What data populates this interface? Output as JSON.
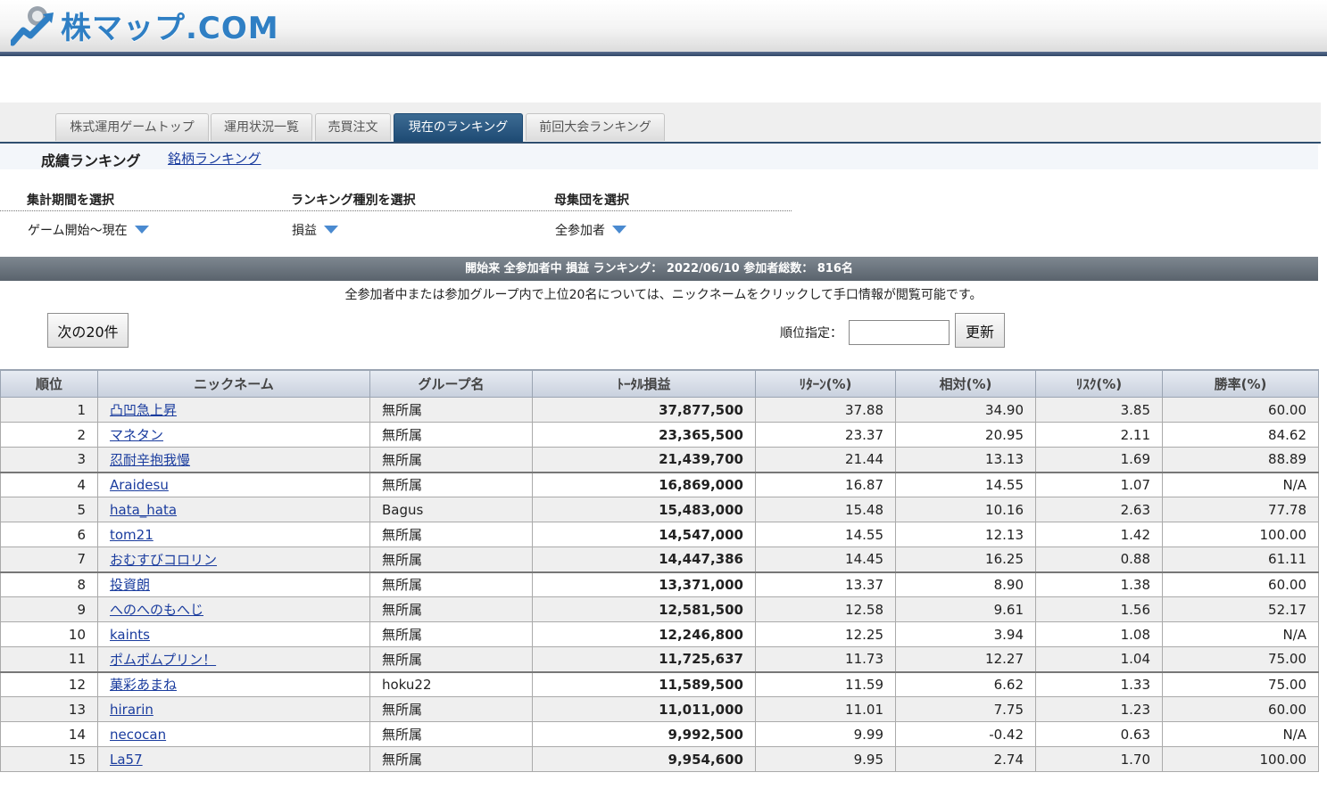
{
  "site": {
    "logo_text": "株マップ.COM"
  },
  "tabs": [
    {
      "label": "株式運用ゲームトップ"
    },
    {
      "label": "運用状況一覧"
    },
    {
      "label": "売買注文"
    },
    {
      "label": "現在のランキング",
      "active": true
    },
    {
      "label": "前回大会ランキング"
    }
  ],
  "subnav": {
    "current": "成績ランキング",
    "link": "銘柄ランキング"
  },
  "filters": [
    {
      "heading": "集計期間を選択",
      "value": "ゲーム開始～現在"
    },
    {
      "heading": "ランキング種別を選択",
      "value": "損益"
    },
    {
      "heading": "母集団を選択",
      "value": "全参加者"
    }
  ],
  "ranking_title": "開始来 全参加者中 損益 ランキング： 2022/06/10 参加者総数： 816名",
  "notice": "全参加者中または参加グループ内で上位20名については、ニックネームをクリックして手口情報が閲覧可能です。",
  "controls": {
    "next_button": "次の20件",
    "rank_label": "順位指定：",
    "rank_input_value": "",
    "update_button": "更新"
  },
  "table": {
    "headers": [
      "順位",
      "ニックネーム",
      "グループ名",
      "ﾄｰﾀﾙ損益",
      "ﾘﾀｰﾝ(%)",
      "相対(%)",
      "ﾘｽｸ(%)",
      "勝率(%)"
    ],
    "rows": [
      [
        "1",
        "凸凹急上昇",
        "無所属",
        "37,877,500",
        "37.88",
        "34.90",
        "3.85",
        "60.00"
      ],
      [
        "2",
        "マネタン",
        "無所属",
        "23,365,500",
        "23.37",
        "20.95",
        "2.11",
        "84.62"
      ],
      [
        "3",
        "忍耐辛抱我慢",
        "無所属",
        "21,439,700",
        "21.44",
        "13.13",
        "1.69",
        "88.89"
      ],
      [
        "4",
        "Araidesu",
        "無所属",
        "16,869,000",
        "16.87",
        "14.55",
        "1.07",
        "N/A"
      ],
      [
        "5",
        "hata_hata",
        "Bagus",
        "15,483,000",
        "15.48",
        "10.16",
        "2.63",
        "77.78"
      ],
      [
        "6",
        "tom21",
        "無所属",
        "14,547,000",
        "14.55",
        "12.13",
        "1.42",
        "100.00"
      ],
      [
        "7",
        "おむすびコロリン",
        "無所属",
        "14,447,386",
        "14.45",
        "16.25",
        "0.88",
        "61.11"
      ],
      [
        "8",
        "投資朗",
        "無所属",
        "13,371,000",
        "13.37",
        "8.90",
        "1.38",
        "60.00"
      ],
      [
        "9",
        "へのへのもへじ",
        "無所属",
        "12,581,500",
        "12.58",
        "9.61",
        "1.56",
        "52.17"
      ],
      [
        "10",
        "kaints",
        "無所属",
        "12,246,800",
        "12.25",
        "3.94",
        "1.08",
        "N/A"
      ],
      [
        "11",
        "ポムポムプリン！",
        "無所属",
        "11,725,637",
        "11.73",
        "12.27",
        "1.04",
        "75.00"
      ],
      [
        "12",
        "菓彩あまね",
        "hoku22",
        "11,589,500",
        "11.59",
        "6.62",
        "1.33",
        "75.00"
      ],
      [
        "13",
        "hirarin",
        "無所属",
        "11,011,000",
        "11.01",
        "7.75",
        "1.23",
        "60.00"
      ],
      [
        "14",
        "necocan",
        "無所属",
        "9,992,500",
        "9.99",
        "-0.42",
        "0.63",
        "N/A"
      ],
      [
        "15",
        "La57",
        "無所属",
        "9,954,600",
        "9.95",
        "2.74",
        "1.70",
        "100.00"
      ]
    ]
  }
}
